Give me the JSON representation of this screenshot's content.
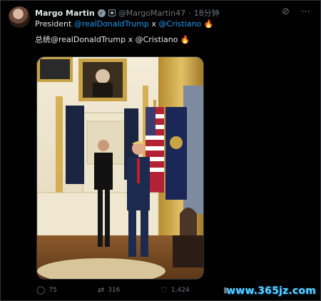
{
  "author": {
    "name": "Margo Martin",
    "handle": "@MargoMartin47",
    "separator": "·",
    "time": "18分钟",
    "verified_icon": "verified-badge-icon",
    "affiliation_icon": "government-badge-icon"
  },
  "header_icons": [
    "grok-icon",
    "more-icon"
  ],
  "tweet": {
    "line1_prefix": "President ",
    "line1_mention1": "@realDonaldTrump",
    "line1_mid": " x ",
    "line1_mention2": "@Cristiano",
    "line1_emoji": "🔥",
    "line2_text": "总统@realDonaldTrump x @Cristiano",
    "line2_emoji": "🔥"
  },
  "actions": {
    "reply_count": "75",
    "repost_count": "316",
    "like_count": "1,424",
    "views_icon": "views-icon"
  },
  "watermark": "www.365jz.com",
  "colors": {
    "background": "#000000",
    "text": "#e7e9ea",
    "muted": "#71767b",
    "link": "#1d9bf0",
    "watermark": "#5fd3ff"
  }
}
